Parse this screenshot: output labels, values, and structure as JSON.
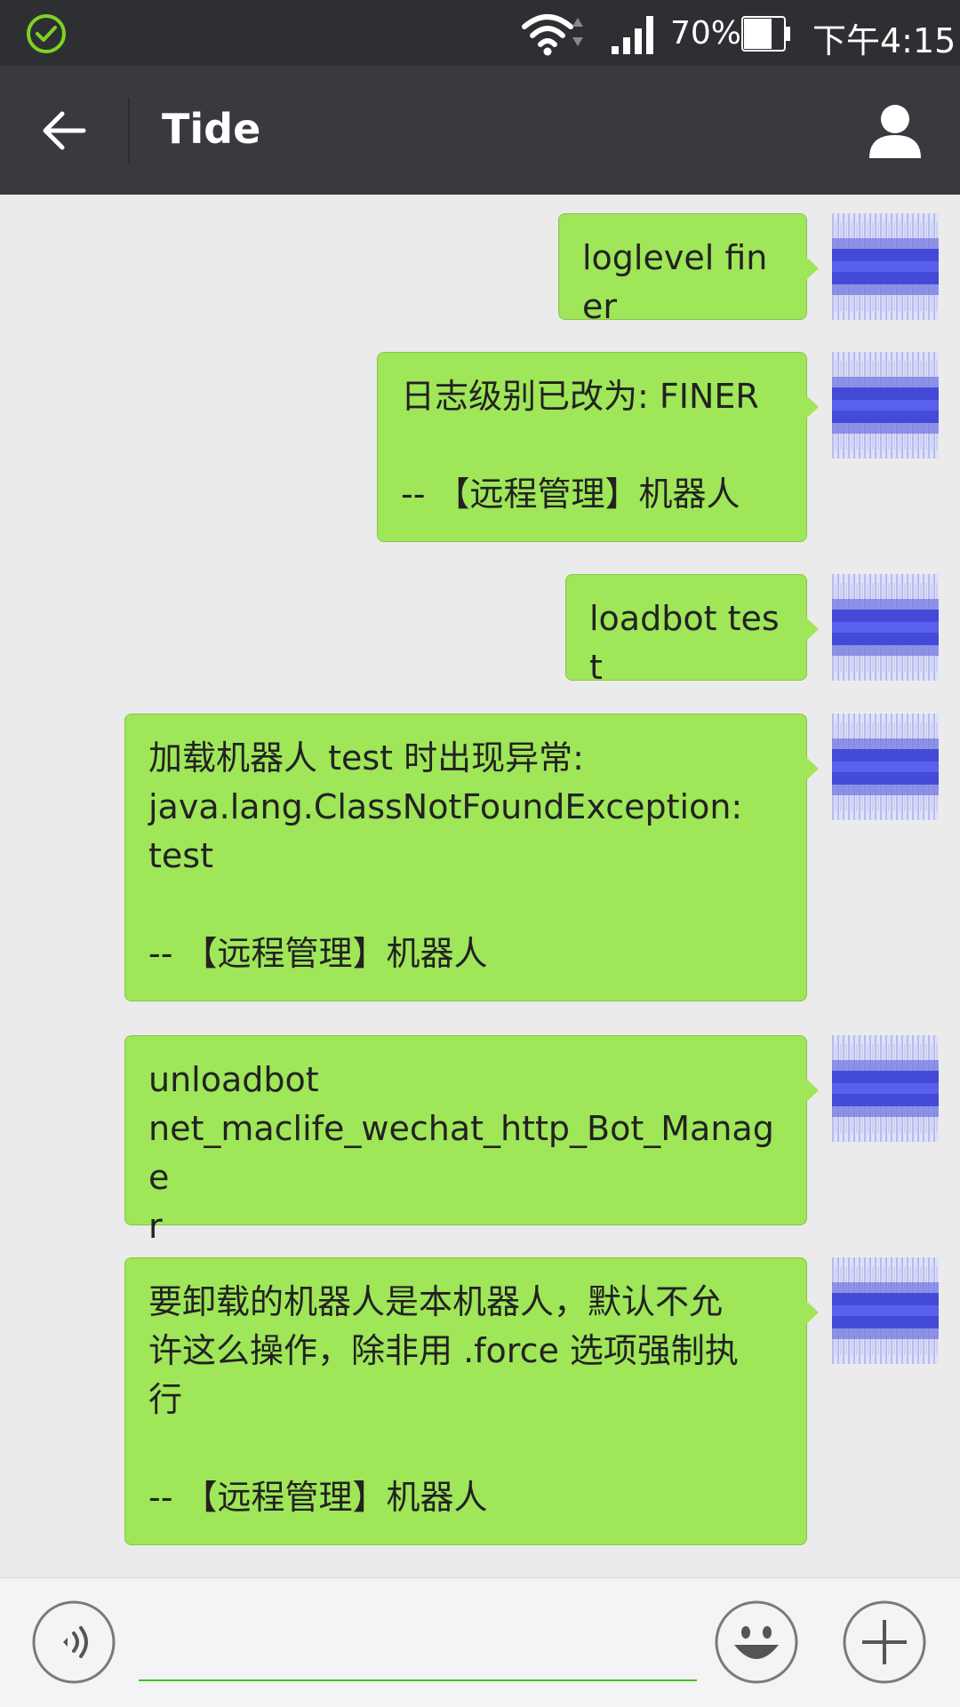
{
  "status_bar": {
    "battery_percent": "70%",
    "time": "下午4:15",
    "icons": [
      "check-circle-icon",
      "wifi-icon",
      "signal-icon",
      "battery-icon"
    ],
    "check_color": "#7ed321"
  },
  "header": {
    "title": "Tide",
    "icons": [
      "back-arrow-icon",
      "person-icon"
    ]
  },
  "messages": [
    {
      "text": "loglevel finer"
    },
    {
      "text": "日志级别已改为: FINER\n\n-- 【远程管理】机器人"
    },
    {
      "text": "loadbot test"
    },
    {
      "text": "加载机器人 test 时出现异常:\njava.lang.ClassNotFoundException:\ntest\n\n-- 【远程管理】机器人"
    },
    {
      "text": "unloadbot\nnet_maclife_wechat_http_Bot_Manage\nr"
    },
    {
      "text": "要卸载的机器人是本机器人，默认不允\n许这么操作，除非用 .force 选项强制执\n行\n\n-- 【远程管理】机器人"
    }
  ],
  "colors": {
    "bubble": "#9fe658",
    "header_bg": "#393a3f",
    "status_bg": "#2e2f33",
    "chat_bg": "#ebebeb",
    "avatar_blue": "#3d43d6"
  },
  "input_bar": {
    "value": "",
    "placeholder": "",
    "icons": [
      "voice-icon",
      "emoji-icon",
      "plus-icon"
    ]
  }
}
